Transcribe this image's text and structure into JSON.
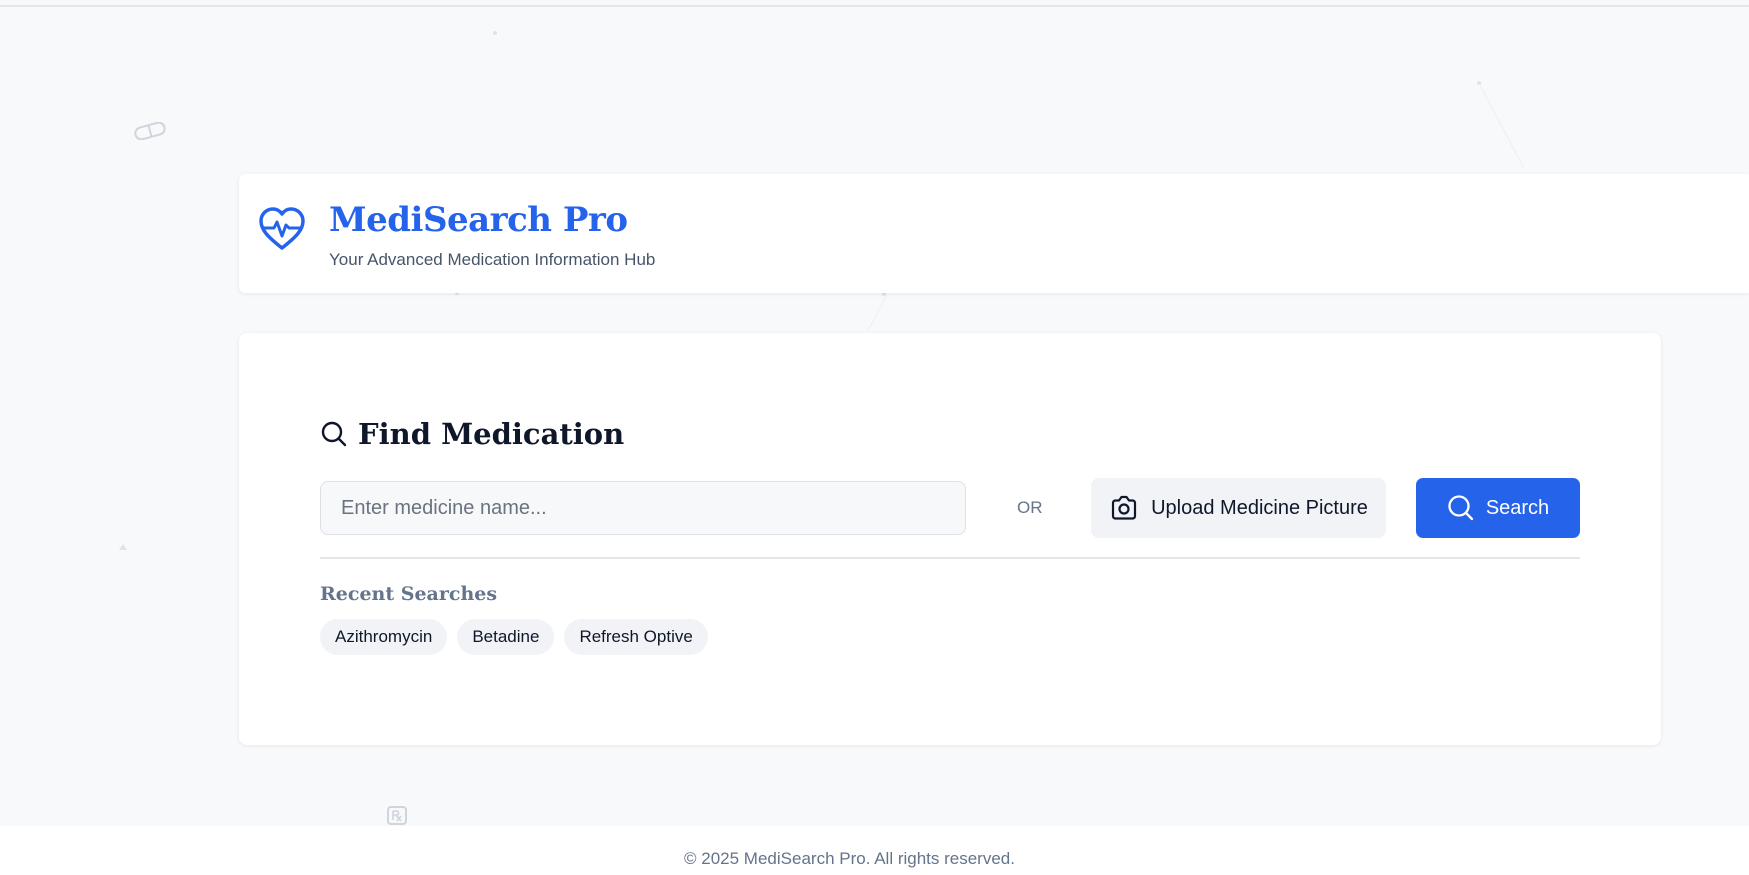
{
  "brand": {
    "title": "MediSearch Pro",
    "subtitle": "Your Advanced Medication Information Hub",
    "logo_icon": "heart-pulse-icon",
    "accent_color": "#2563eb"
  },
  "search": {
    "section_title": "Find Medication",
    "section_icon": "search-icon",
    "input_placeholder": "Enter medicine name...",
    "input_value": "",
    "or_label": "OR",
    "upload_label": "Upload Medicine Picture",
    "upload_icon": "camera-icon",
    "search_label": "Search",
    "search_icon": "search-icon"
  },
  "recent": {
    "title": "Recent Searches",
    "items": [
      "Azithromycin",
      "Betadine",
      "Refresh Optive"
    ]
  },
  "footer": {
    "text": "© 2025 MediSearch Pro. All rights reserved."
  },
  "decorations": {
    "pill_icon": "pill-icon",
    "footer_icon": "prescription-icon"
  }
}
